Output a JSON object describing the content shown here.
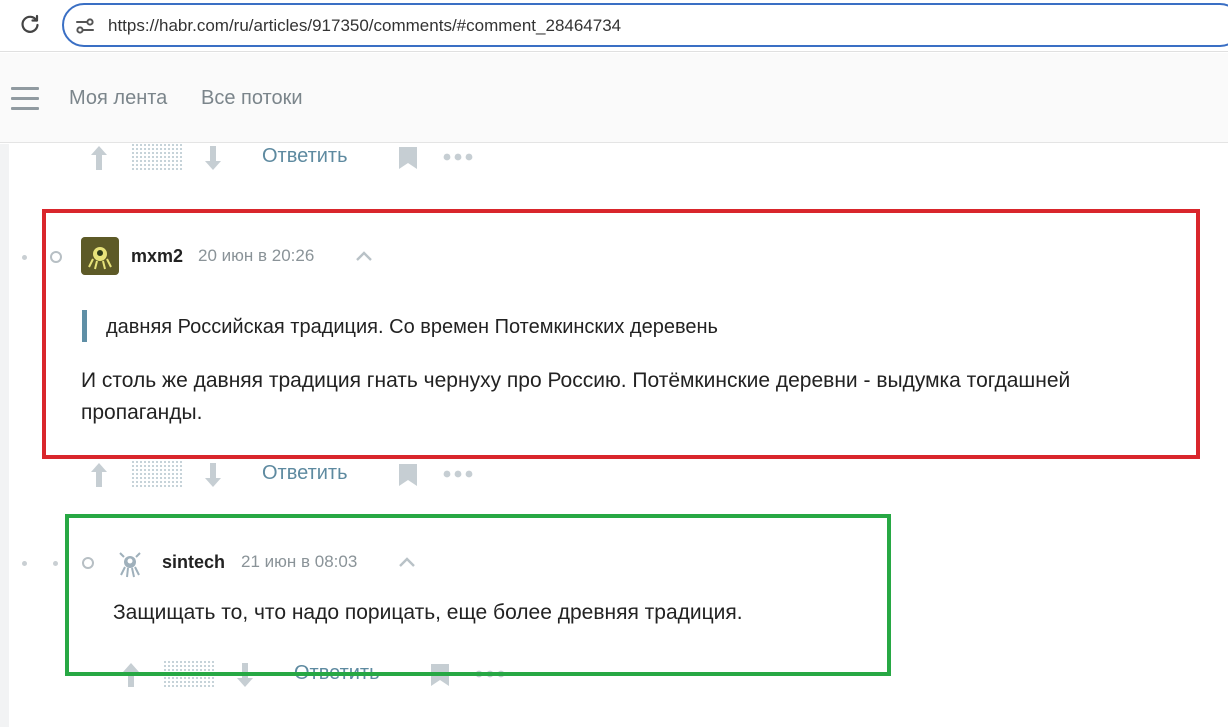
{
  "browser": {
    "url": "https://habr.com/ru/articles/917350/comments/#comment_28464734"
  },
  "header": {
    "nav": [
      "Моя лента",
      "Все потоки"
    ]
  },
  "actions": {
    "reply_label": "Ответить"
  },
  "comments": [
    {
      "username": "mxm2",
      "datetime": "20 июн в 20:26",
      "quote": "давняя Российская традиция. Со времен Потемкинских деревень",
      "body": "И столь же давняя традиция гнать чернуху про Россию. Потёмкинские деревни - выдумка тогдашней пропаганды."
    },
    {
      "username": "sintech",
      "datetime": "21 июн в 08:03",
      "body": "Защищать то, что надо порицать, еще более древняя традиция."
    }
  ],
  "colors": {
    "highlight_red": "#d9262c",
    "highlight_green": "#27a844",
    "link": "#5e8aa0",
    "quote_bar": "#5f8fa6"
  }
}
